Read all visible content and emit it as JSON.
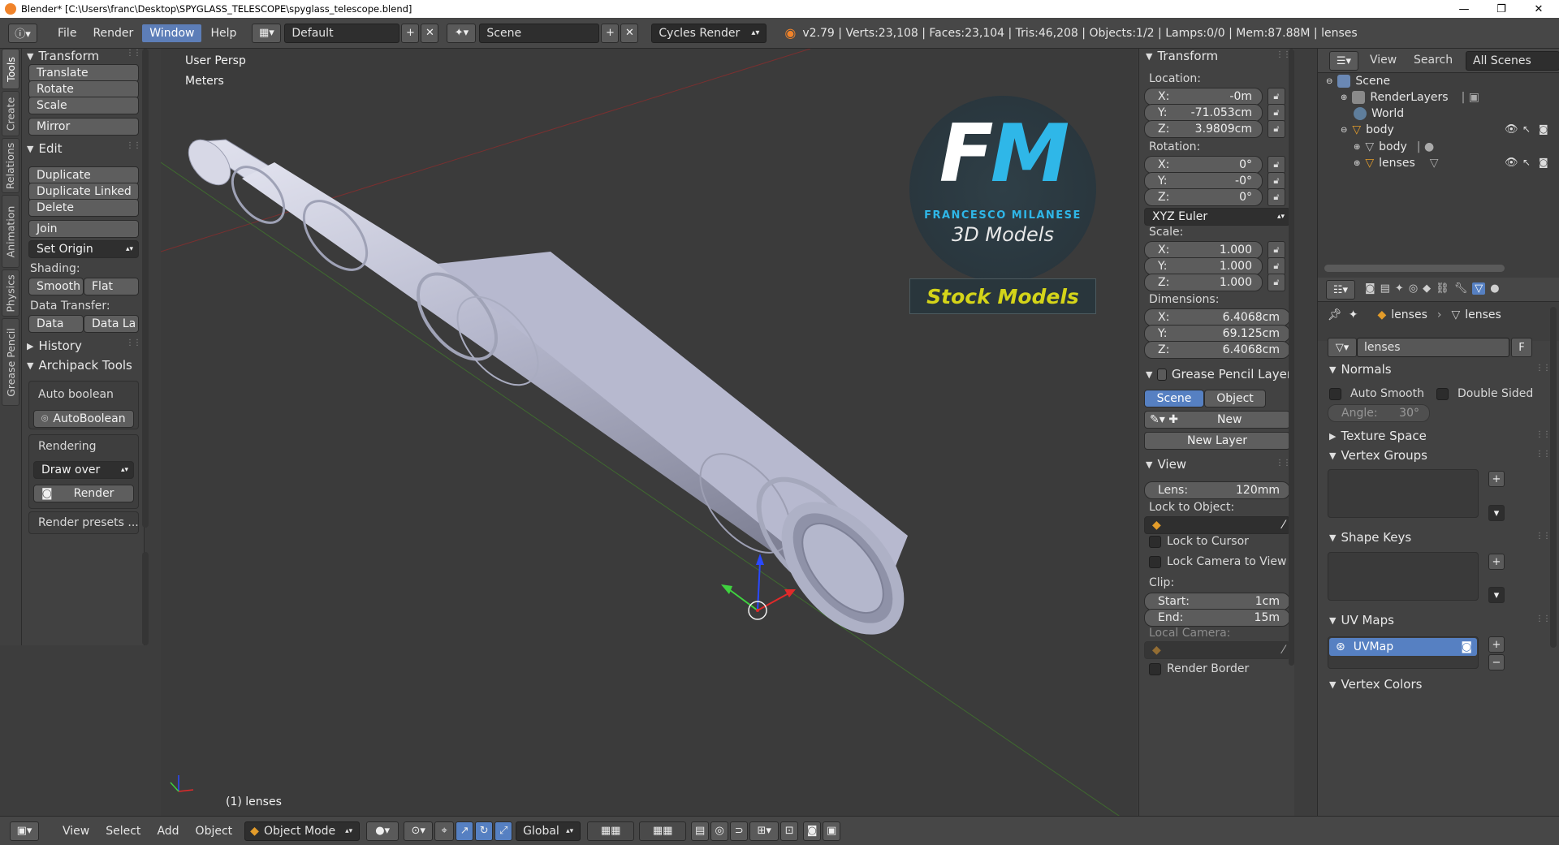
{
  "window": {
    "title": "Blender* [C:\\Users\\franc\\Desktop\\SPYGLASS_TELESCOPE\\spyglass_telescope.blend]",
    "minimize": "—",
    "maximize": "❐",
    "close": "✕"
  },
  "menubar": {
    "menus": [
      "File",
      "Render",
      "Window",
      "Help"
    ],
    "active_menu": "Window",
    "layout": "Default",
    "scene": "Scene",
    "engine": "Cycles Render",
    "stats": "v2.79 | Verts:23,108 | Faces:23,104 | Tris:46,208 | Objects:1/2 | Lamps:0/0 | Mem:87.88M | lenses"
  },
  "vtabs": [
    "Tools",
    "Create",
    "Relations",
    "Animation",
    "Physics",
    "Grease Pencil"
  ],
  "toolshelf": {
    "transform_header": "Transform",
    "transform_buttons": [
      "Translate",
      "Rotate",
      "Scale"
    ],
    "mirror": "Mirror",
    "edit_header": "Edit",
    "edit_buttons": [
      "Duplicate",
      "Duplicate Linked",
      "Delete"
    ],
    "join": "Join",
    "set_origin": "Set Origin",
    "shading_label": "Shading:",
    "smooth": "Smooth",
    "flat": "Flat",
    "data_transfer_label": "Data Transfer:",
    "data": "Data",
    "data_la": "Data La",
    "history_header": "History",
    "archipack_header": "Archipack Tools",
    "auto_boolean_label": "Auto boolean",
    "autoboolean_button": "AutoBoolean",
    "rendering_label": "Rendering",
    "draw_over": "Draw over",
    "render_button": "Render",
    "render_presets": "Render presets ..."
  },
  "viewport": {
    "view_name": "User Persp",
    "units": "Meters",
    "object_label": "(1) lenses",
    "watermark": {
      "letters": "FM",
      "name": "FRANCESCO MILANESE",
      "sub": "3D Models",
      "banner": "Stock Models"
    }
  },
  "properties": {
    "transform_header": "Transform",
    "location_label": "Location:",
    "location": [
      {
        "axis": "X:",
        "value": "-0m"
      },
      {
        "axis": "Y:",
        "value": "-71.053cm"
      },
      {
        "axis": "Z:",
        "value": "3.9809cm"
      }
    ],
    "rotation_label": "Rotation:",
    "rotation": [
      {
        "axis": "X:",
        "value": "0°"
      },
      {
        "axis": "Y:",
        "value": "-0°"
      },
      {
        "axis": "Z:",
        "value": "0°"
      }
    ],
    "rotation_mode": "XYZ Euler",
    "scale_label": "Scale:",
    "scale": [
      {
        "axis": "X:",
        "value": "1.000"
      },
      {
        "axis": "Y:",
        "value": "1.000"
      },
      {
        "axis": "Z:",
        "value": "1.000"
      }
    ],
    "dimensions_label": "Dimensions:",
    "dimensions": [
      {
        "axis": "X:",
        "value": "6.4068cm"
      },
      {
        "axis": "Y:",
        "value": "69.125cm"
      },
      {
        "axis": "Z:",
        "value": "6.4068cm"
      }
    ],
    "gp_header": "Grease Pencil Layer",
    "gp_scene": "Scene",
    "gp_object": "Object",
    "gp_new": "New",
    "gp_new_layer": "New Layer",
    "view_header": "View",
    "lens_label": "Lens:",
    "lens_value": "120mm",
    "lock_to_object": "Lock to Object:",
    "lock_to_cursor": "Lock to Cursor",
    "lock_camera": "Lock Camera to View",
    "clip_label": "Clip:",
    "clip_start_label": "Start:",
    "clip_start": "1cm",
    "clip_end_label": "End:",
    "clip_end": "15m",
    "local_camera": "Local Camera:",
    "render_border": "Render Border"
  },
  "outliner": {
    "menu_view": "View",
    "menu_search": "Search",
    "scope": "All Scenes",
    "items": [
      {
        "label": "Scene"
      },
      {
        "label": "RenderLayers"
      },
      {
        "label": "World"
      },
      {
        "label": "body"
      },
      {
        "label": "body"
      },
      {
        "label": "lenses"
      }
    ]
  },
  "data_props": {
    "breadcrumb_obj": "lenses",
    "breadcrumb_mesh": "lenses",
    "mesh_name": "lenses",
    "fake_user": "F",
    "normals_header": "Normals",
    "auto_smooth": "Auto Smooth",
    "double_sided": "Double Sided",
    "angle": "Angle:",
    "angle_value": "30°",
    "texture_space": "Texture Space",
    "vertex_groups": "Vertex Groups",
    "shape_keys": "Shape Keys",
    "uv_maps": "UV Maps",
    "uvmap_item": "UVMap",
    "vertex_colors": "Vertex Colors"
  },
  "statusbar": {
    "menus": [
      "View",
      "Select",
      "Add",
      "Object"
    ],
    "mode": "Object Mode",
    "orientation": "Global"
  },
  "colors": {
    "accent_blue": "#5680c2",
    "panel_bg": "#424242",
    "viewport_bg": "#3b3b3b",
    "telescope": "#b3b6cc",
    "banner_text": "#d4d419"
  }
}
